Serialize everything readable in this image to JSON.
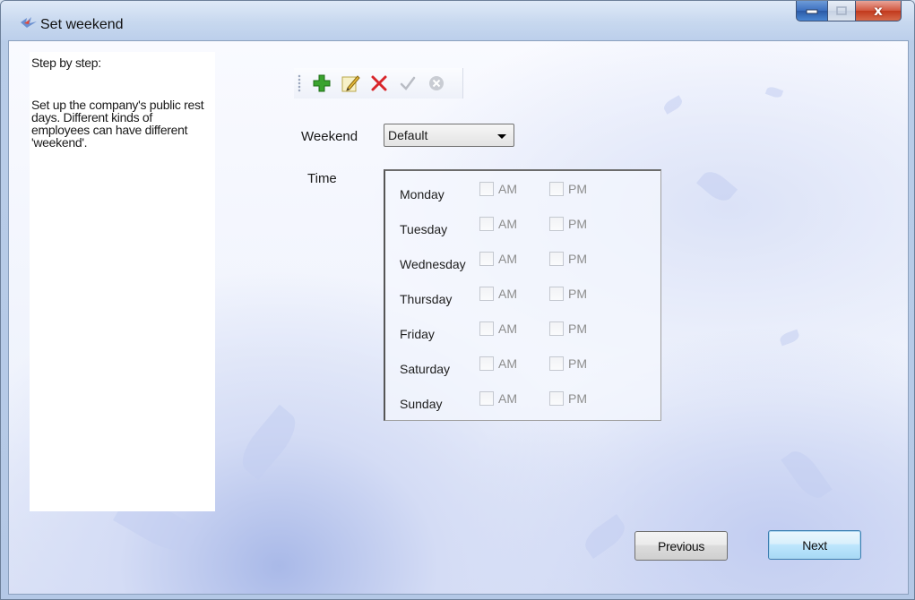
{
  "window": {
    "title": "Set weekend",
    "controls": {
      "minimize_icon": "minimize-icon",
      "maximize_icon": "maximize-icon",
      "close_icon": "close-icon",
      "close_glyph": "x"
    }
  },
  "help": {
    "title": "Step by step:",
    "body": "Set up the company's public rest days. Different kinds of employees can have different 'weekend'."
  },
  "toolbar": {
    "icons": [
      "add-icon",
      "edit-icon",
      "delete-icon",
      "confirm-icon",
      "cancel-icon"
    ]
  },
  "form": {
    "weekend_label": "Weekend",
    "weekend_value": "Default",
    "time_label": "Time",
    "am_label": "AM",
    "pm_label": "PM",
    "days": [
      {
        "name": "Monday",
        "am": false,
        "pm": false
      },
      {
        "name": "Tuesday",
        "am": false,
        "pm": false
      },
      {
        "name": "Wednesday",
        "am": false,
        "pm": false
      },
      {
        "name": "Thursday",
        "am": false,
        "pm": false
      },
      {
        "name": "Friday",
        "am": false,
        "pm": false
      },
      {
        "name": "Saturday",
        "am": false,
        "pm": false
      },
      {
        "name": "Sunday",
        "am": false,
        "pm": false
      }
    ]
  },
  "buttons": {
    "previous": "Previous",
    "next": "Next"
  },
  "colors": {
    "add": "#3aa32e",
    "delete": "#d8262b",
    "disabled": "#b9bcc4",
    "next_border": "#3c7fb1"
  }
}
